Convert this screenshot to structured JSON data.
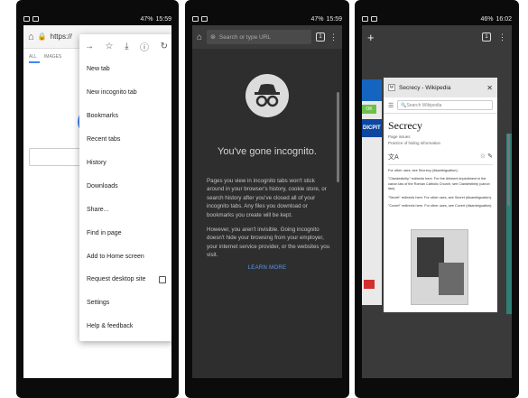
{
  "phone1": {
    "status": {
      "time": "15:59",
      "battery": "47%"
    },
    "toolbar": {
      "url_text": "https://w"
    },
    "tabs": [
      "ALL",
      "IMAGES"
    ],
    "menu": {
      "items": [
        "New tab",
        "New incognito tab",
        "Bookmarks",
        "Recent tabs",
        "History",
        "Downloads",
        "Share...",
        "Find in page",
        "Add to Home screen",
        "Request desktop site",
        "Settings",
        "Help & feedback"
      ],
      "request_desktop_checked": false
    }
  },
  "phone2": {
    "status": {
      "time": "15:59",
      "battery": "47%"
    },
    "toolbar": {
      "placeholder": "Search or type URL",
      "tab_count": "1"
    },
    "title": "You've gone incognito.",
    "para1": "Pages you view in incognito tabs won't stick around in your browser's history, cookie store, or search history after you've closed all of your incognito tabs. Any files you download or bookmarks you create will be kept.",
    "para2": "However, you aren't invisible. Going incognito doesn't hide your browsing from your employer, your internet service provider, or the websites you visit.",
    "learn_more": "LEARN MORE"
  },
  "phone3": {
    "status": {
      "time": "16:02",
      "battery": "46%"
    },
    "toolbar": {
      "tab_count": "1"
    },
    "back_tab": {
      "ok": "OK",
      "band": "DICPIT"
    },
    "card": {
      "header_title": "Secrecy - Wikipedia",
      "search_placeholder": "Search Wikipedia",
      "heading": "Secrecy",
      "subline1": "Page issues",
      "subline2": "Practice of hiding information",
      "note1": "For other uses, see Secrecy (disambiguation).",
      "note2": "\"Clandestinity\" redirects here. For the diriment impediment in the canon law of the Roman Catholic Church, see Clandestinity (canon law).",
      "note3": "\"Secret\" redirects here. For other uses, see Secret (disambiguation).",
      "note4": "\"Covert\" redirects here. For other uses, see Covert (disambiguation)."
    }
  }
}
